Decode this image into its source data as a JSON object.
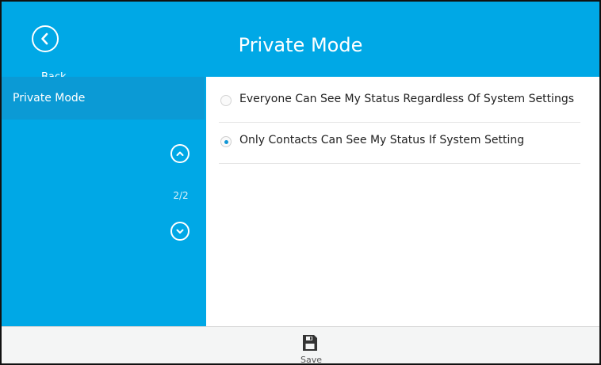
{
  "header": {
    "title": "Private Mode",
    "back_label": "Back"
  },
  "sidebar": {
    "items": [
      {
        "label": "Private Mode",
        "selected": true
      }
    ],
    "pager": {
      "text": "2/2"
    }
  },
  "options": [
    {
      "label": "Everyone Can See My Status Regardless Of System Settings",
      "checked": false
    },
    {
      "label": "Only Contacts Can See My Status If System Setting",
      "checked": true
    }
  ],
  "footer": {
    "save_label": "Save",
    "save_icon": "save-icon"
  },
  "colors": {
    "accent": "#00a8e6",
    "sidebar_selected": "#0b9ad5",
    "radio_selected": "#1197d6"
  }
}
